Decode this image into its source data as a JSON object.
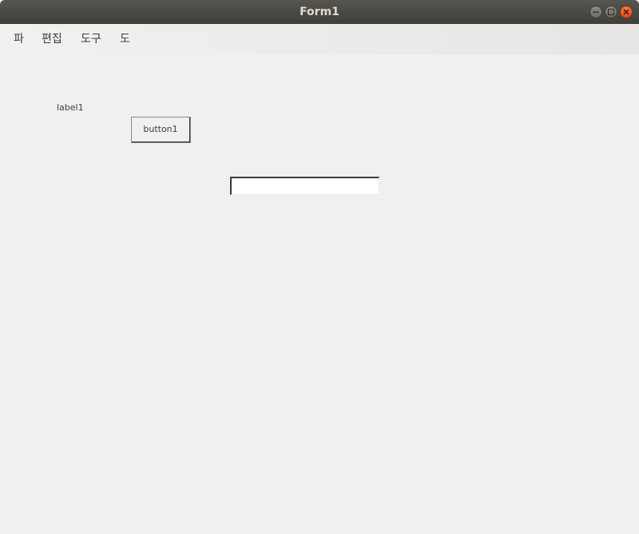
{
  "window": {
    "title": "Form1"
  },
  "menubar": {
    "items": [
      "파",
      "편집",
      "도구",
      "도"
    ]
  },
  "form": {
    "label1": "label1",
    "button1": "button1",
    "textbox1_value": ""
  },
  "colors": {
    "titlebar": "#3f3e3a",
    "close_button": "#df4b16",
    "background": "#f1f0ee"
  }
}
